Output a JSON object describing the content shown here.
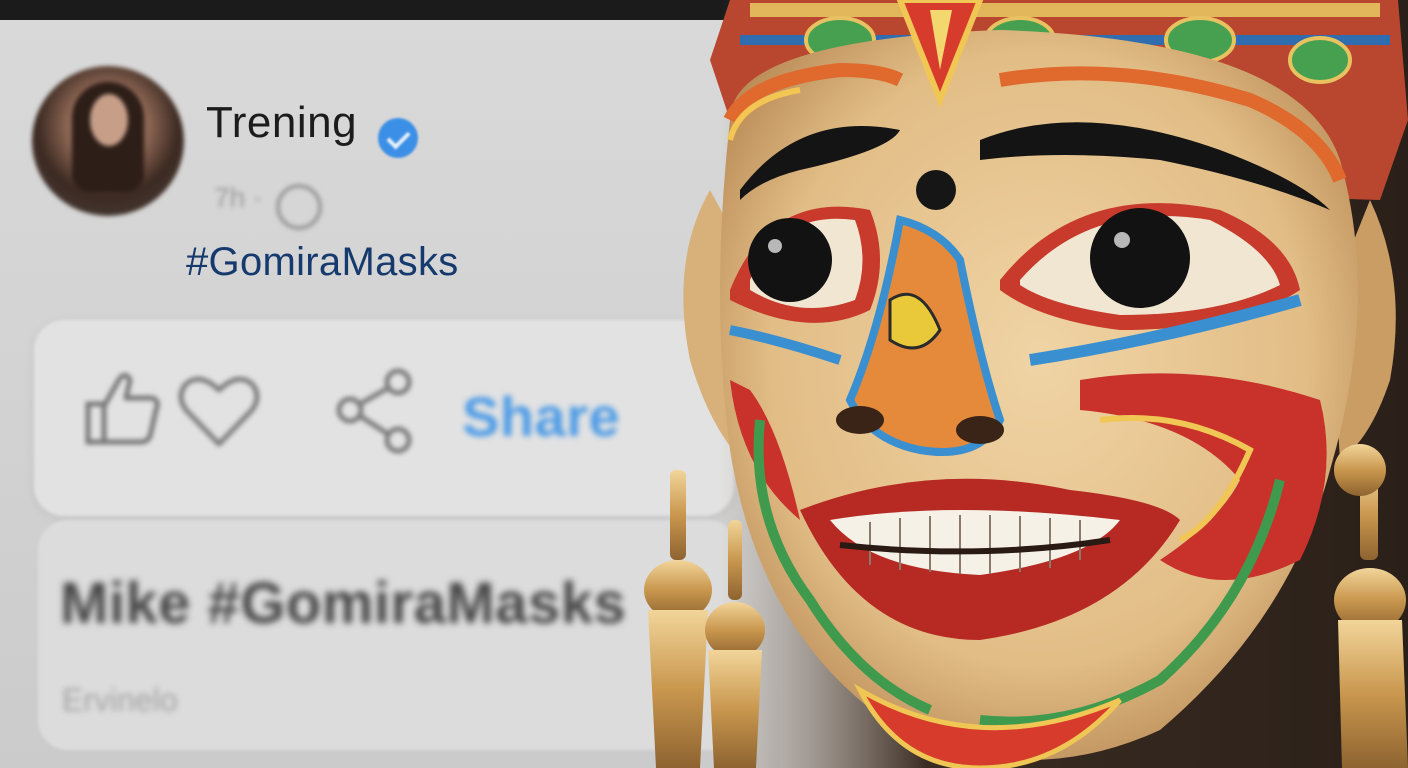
{
  "post": {
    "author_name": "Trening",
    "meta": "7h ·",
    "hashtag": "#GomiraMasks"
  },
  "actions": {
    "share_label": "Share"
  },
  "comment": {
    "text": "Mike #GomiraMasks",
    "subtext": "Ervinelo"
  },
  "colors": {
    "verified_badge": "#3b8fe6",
    "hashtag": "#163a6e",
    "share_label": "#4d9be6",
    "mask_gold": "#e5c596",
    "mask_red": "#c8322a",
    "mask_blue": "#3a8fd0",
    "mask_green": "#3f9a4e"
  },
  "icons": [
    "verified-check-icon",
    "globe-icon",
    "thumbs-up-icon",
    "heart-icon",
    "share-nodes-icon"
  ]
}
